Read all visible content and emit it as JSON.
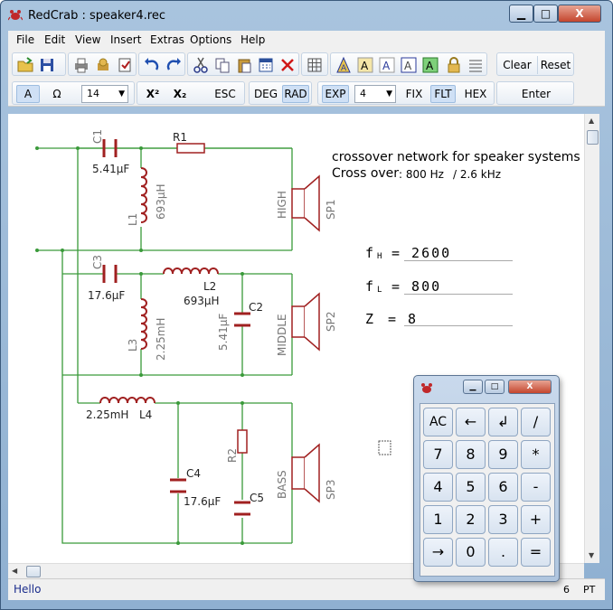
{
  "window": {
    "title": "RedCrab : speaker4.rec",
    "min_label": "▁",
    "max_label": "□",
    "close_label": "X"
  },
  "menu": {
    "items": [
      "File",
      "Edit",
      "View",
      "Insert",
      "Extras",
      "Options",
      "Help"
    ]
  },
  "toolbar1": {
    "icons": [
      "open-folder-icon",
      "save-icon",
      "print-icon",
      "print-preview-icon",
      "page-setup-icon",
      "undo-icon",
      "redo-icon",
      "cut-icon",
      "copy-icon",
      "paste-icon",
      "calculator-icon",
      "delete-icon",
      "grid-icon",
      "font-color-icon",
      "font-a-icon",
      "font-a-outline-icon",
      "font-a-frame-icon",
      "font-a-green-icon",
      "lock-icon",
      "lines-icon"
    ],
    "clear_label": "Clear",
    "reset_label": "Reset"
  },
  "toolbar2": {
    "a_label": "A",
    "omega_label": "Ω",
    "font_size": "14",
    "x2_label": "X²",
    "x_sub2_label": "X₂",
    "esc_label": "ESC",
    "deg_label": "DEG",
    "rad_label": "RAD",
    "exp_label": "EXP",
    "digits": "4",
    "fix_label": "FIX",
    "flt_label": "FLT",
    "hex_label": "HEX",
    "enter_label": "Enter"
  },
  "schematic": {
    "c1": "C1",
    "c1_val": "5.41µF",
    "r1": "R1",
    "l1": "L1",
    "l1_val": "693µH",
    "high": "HIGH",
    "sp1": "SP1",
    "c3": "C3",
    "c3_val": "17.6µF",
    "l2": "L2",
    "l2_val": "693µH",
    "l3": "L3",
    "l3_val": "2.25mH",
    "c2": "C2",
    "c2_val": "5.41µF",
    "middle": "MIDDLE",
    "sp2": "SP2",
    "l4": "L4",
    "l4_val": "2.25mH",
    "r2": "R2",
    "c4": "C4",
    "c4_val": "17.6µF",
    "c5": "C5",
    "bass": "BASS",
    "sp3": "SP3"
  },
  "notes": {
    "line1": "crossover network for speaker systems",
    "line2_prefix": "Cross over",
    "line2_f1": ": 800 Hz",
    "line2_f2": "/ 2.6 kHz"
  },
  "formulas": {
    "fh_name": "f",
    "fh_sub": "H",
    "fh_val": "= 2600",
    "fl_name": "f",
    "fl_sub": "L",
    "fl_val": "= 800",
    "z_name": "Z",
    "z_val": "= 8"
  },
  "keypad": {
    "keys": [
      "AC",
      "←",
      "↲",
      "/",
      "7",
      "8",
      "9",
      "*",
      "4",
      "5",
      "6",
      "-",
      "1",
      "2",
      "3",
      "+",
      "→",
      "0",
      ".",
      "="
    ]
  },
  "status": {
    "message": "Hello",
    "number": "6",
    "unit": "PT"
  }
}
